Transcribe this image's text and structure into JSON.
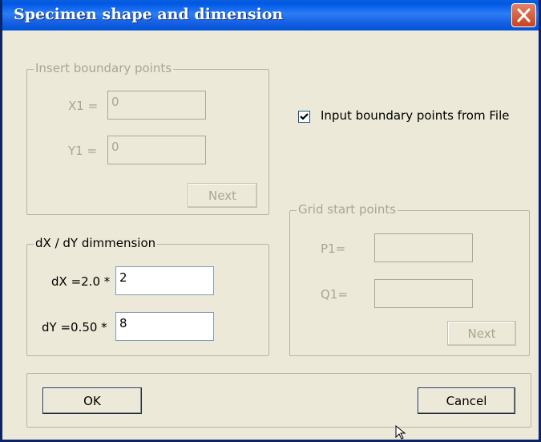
{
  "window": {
    "title": "Specimen shape and dimension"
  },
  "boundary_group": {
    "label": "Insert boundary points",
    "x1_label": "X1 =",
    "x1_value": "0",
    "y1_label": "Y1 =",
    "y1_value": "0",
    "next_label": "Next"
  },
  "checkbox": {
    "label": "Input boundary points from File",
    "checked": true
  },
  "dimension_group": {
    "label": "dX / dY dimmension",
    "dx_label": "dX =2.0 *",
    "dx_value": "2",
    "dy_label": "dY =0.50 *",
    "dy_value": "8"
  },
  "grid_group": {
    "label": "Grid start points",
    "p1_label": "P1=",
    "p1_value": "",
    "q1_label": "Q1=",
    "q1_value": "",
    "next_label": "Next"
  },
  "buttons": {
    "ok_label": "OK",
    "cancel_label": "Cancel"
  },
  "icons": {
    "close": "close-icon",
    "check": "checkmark-icon",
    "cursor": "mouse-cursor-icon"
  }
}
